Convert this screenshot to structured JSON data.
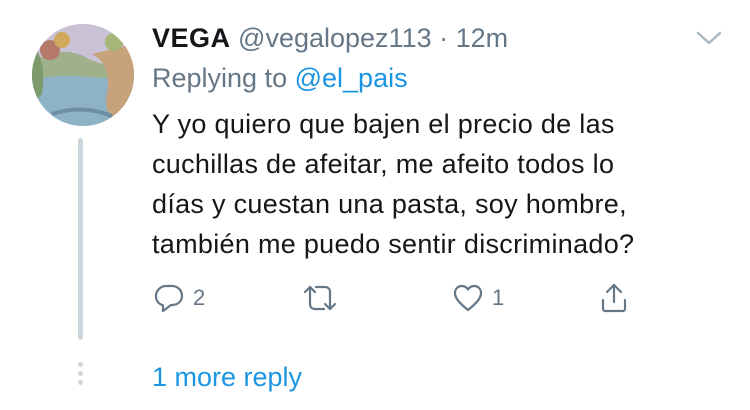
{
  "tweet": {
    "display_name": "VEGA",
    "handle": "@vegalopez113",
    "separator": "·",
    "time": "12m",
    "replying_prefix": "Replying to",
    "replying_to": "@el_pais",
    "text_lines": [
      "Y yo quiero que bajen el precio de las",
      "cuchillas de afeitar, me afeito todos lo",
      "días y cuestan una pasta, soy hombre,",
      "también me puedo sentir discriminado?"
    ]
  },
  "actions": {
    "reply": {
      "icon": "reply-icon",
      "count": "2"
    },
    "retweet": {
      "icon": "retweet-icon",
      "count": ""
    },
    "like": {
      "icon": "heart-icon",
      "count": "1"
    },
    "share": {
      "icon": "share-icon"
    }
  },
  "thread": {
    "more_replies_label": "1 more reply"
  },
  "colors": {
    "text": "#14171a",
    "secondary": "#657786",
    "link": "#1b95e0",
    "thread_line": "#ccd6dd"
  }
}
